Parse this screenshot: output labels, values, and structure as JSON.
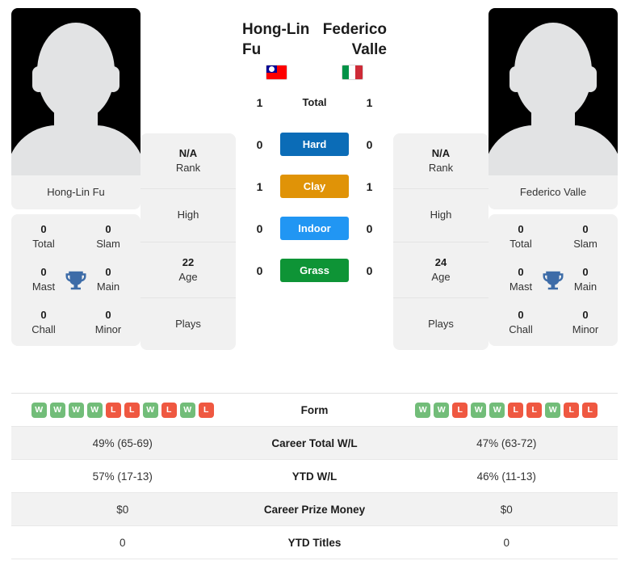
{
  "players": {
    "left": {
      "name": "Hong-Lin Fu",
      "photo_caption": "Hong-Lin Fu",
      "flag": "taiwan-flag",
      "titles": [
        {
          "num": "0",
          "label": "Total"
        },
        {
          "num": "0",
          "label": "Slam"
        },
        {
          "num": "0",
          "label": "Mast"
        },
        {
          "num": "0",
          "label": "Main"
        },
        {
          "num": "0",
          "label": "Chall"
        },
        {
          "num": "0",
          "label": "Minor"
        }
      ],
      "info": [
        {
          "value": "N/A",
          "key": "Rank"
        },
        {
          "value": "",
          "key": "High"
        },
        {
          "value": "22",
          "key": "Age"
        },
        {
          "value": "",
          "key": "Plays"
        }
      ]
    },
    "right": {
      "name": "Federico Valle",
      "photo_caption": "Federico Valle",
      "flag": "italy-flag",
      "titles": [
        {
          "num": "0",
          "label": "Total"
        },
        {
          "num": "0",
          "label": "Slam"
        },
        {
          "num": "0",
          "label": "Mast"
        },
        {
          "num": "0",
          "label": "Main"
        },
        {
          "num": "0",
          "label": "Chall"
        },
        {
          "num": "0",
          "label": "Minor"
        }
      ],
      "info": [
        {
          "value": "N/A",
          "key": "Rank"
        },
        {
          "value": "",
          "key": "High"
        },
        {
          "value": "24",
          "key": "Age"
        },
        {
          "value": "",
          "key": "Plays"
        }
      ]
    }
  },
  "h2h": [
    {
      "label": "Total",
      "left": "1",
      "right": "1",
      "style": "plain",
      "color": ""
    },
    {
      "label": "Hard",
      "left": "0",
      "right": "0",
      "style": "surf",
      "color": "#0b6cb7"
    },
    {
      "label": "Clay",
      "left": "1",
      "right": "1",
      "style": "surf",
      "color": "#e09307"
    },
    {
      "label": "Indoor",
      "left": "0",
      "right": "0",
      "style": "surf",
      "color": "#2196f3"
    },
    {
      "label": "Grass",
      "left": "0",
      "right": "0",
      "style": "surf",
      "color": "#0e9436"
    }
  ],
  "stats": {
    "form": {
      "label": "Form",
      "left": [
        "W",
        "W",
        "W",
        "W",
        "L",
        "L",
        "W",
        "L",
        "W",
        "L"
      ],
      "right": [
        "W",
        "W",
        "L",
        "W",
        "W",
        "L",
        "L",
        "W",
        "L",
        "L"
      ]
    },
    "rows": [
      {
        "label": "Career Total W/L",
        "left": "49% (65-69)",
        "right": "47% (63-72)"
      },
      {
        "label": "YTD W/L",
        "left": "57% (17-13)",
        "right": "46% (11-13)"
      },
      {
        "label": "Career Prize Money",
        "left": "$0",
        "right": "$0"
      },
      {
        "label": "YTD Titles",
        "left": "0",
        "right": "0"
      }
    ]
  },
  "colors": {
    "win": "#72bd79",
    "loss": "#ef5841",
    "trophy": "#3d6ca8",
    "card_bg": "#f1f1f1",
    "row_alt": "#f2f2f2"
  }
}
